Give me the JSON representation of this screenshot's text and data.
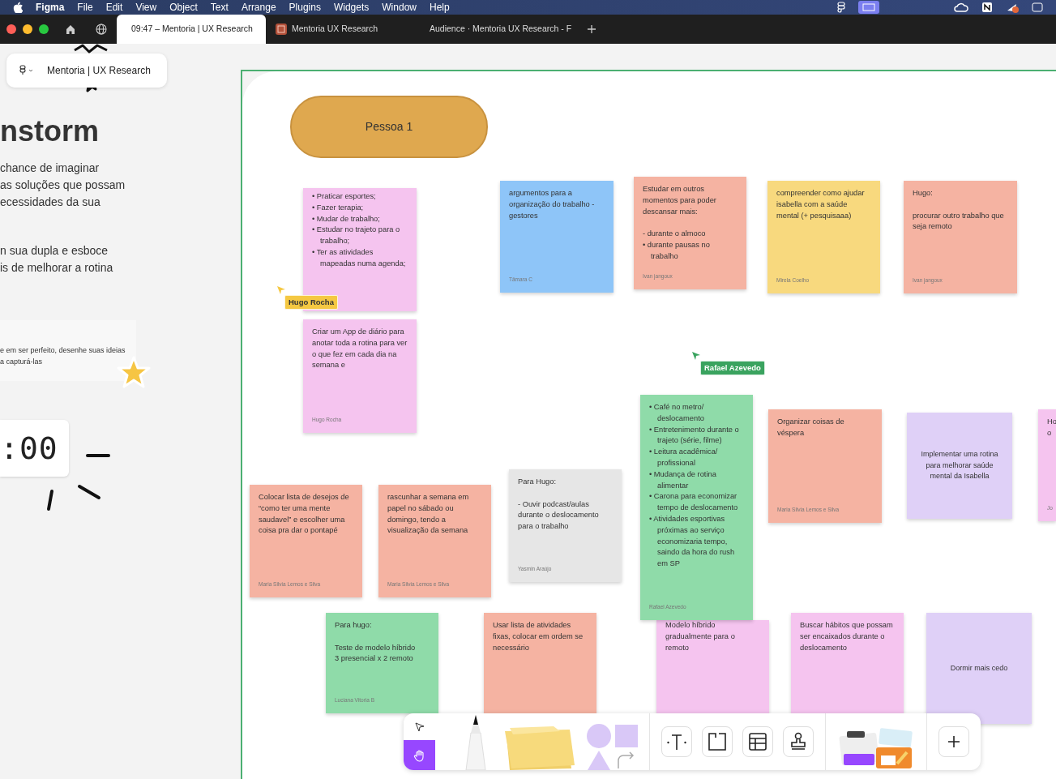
{
  "menu_bar": {
    "app": "Figma",
    "items": [
      "File",
      "Edit",
      "View",
      "Object",
      "Text",
      "Arrange",
      "Plugins",
      "Widgets",
      "Window",
      "Help"
    ]
  },
  "browser_tabs": [
    {
      "label": "09:47 – Mentoria | UX Research",
      "selected": true
    },
    {
      "label": "Mentoria UX Research",
      "selected": false
    },
    {
      "label": "Audience · Mentoria UX Research - F",
      "selected": false
    }
  ],
  "file_pill": {
    "name": "Mentoria | UX Research"
  },
  "instructions": {
    "heading": "nstorm",
    "paragraphs": [
      "chance de imaginar\nas soluções que possam\necessidades da sua",
      "n sua dupla e esboce\nis de melhorar a rotina"
    ],
    "tip": "e em ser perfeito, desenhe suas ideias\na capturá-las",
    "timer": ":00"
  },
  "section": {
    "label": "Pessoa 1"
  },
  "notes": [
    {
      "kind": "plain",
      "color": "#f5c4ef",
      "items": [
        "• Praticar esportes;",
        "• Fazer terapia;",
        "• Mudar de trabalho;",
        "• Estudar no trajeto para o trabalho;",
        "• Ter as atividades mapeadas numa agenda;"
      ]
    },
    {
      "kind": "plain",
      "color": "#8ec5f8",
      "text": "argumentos para a organização do trabalho - gestores",
      "author": "Tâmara C"
    },
    {
      "kind": "plain",
      "color": "#f5b3a2",
      "text": "Estudar em outros momentos para poder descansar mais:\n\n- durante o almoco",
      "items": [
        "• durante pausas no trabalho"
      ],
      "author": "Ivan jangoux"
    },
    {
      "kind": "plain",
      "color": "#f8d97e",
      "text": "compreender como ajudar isabella com a saúde mental (+ pesquisaaa)",
      "author": "Mirela Coelho"
    },
    {
      "kind": "plain",
      "color": "#f5b3a2",
      "text": "Hugo:\n\nprocurar outro trabalho que seja remoto",
      "author": "Ivan jangoux"
    },
    {
      "kind": "plain",
      "color": "#f5c4ef",
      "text": "Criar um App de diário para anotar toda a rotina para ver o que fez em cada dia na semana e",
      "author": "Hugo Rocha"
    },
    {
      "kind": "plain",
      "color": "#8fdba9",
      "items": [
        "• Café no metro/ deslocamento",
        "• Entretenimento durante o trajeto (série, filme)",
        "• Leitura acadêmica/ profissional",
        "• Mudança de rotina alimentar",
        "• Carona para economizar tempo de deslocamento",
        "• Atividades esportivas próximas ao serviço economizaria tempo, saindo da hora do rush em SP"
      ],
      "author": "Rafael Azevedo"
    },
    {
      "kind": "plain",
      "color": "#f5b3a2",
      "text": "Organizar coisas de véspera",
      "author": "Maria Silvia Lemos e Silva"
    },
    {
      "kind": "centered",
      "color": "#dfd0f7",
      "text": "Implementar uma rotina para melhorar saúde mental da Isabella"
    },
    {
      "kind": "plain",
      "color": "#f5c4ef",
      "text": "Ho\no",
      "author": "Jo"
    },
    {
      "kind": "plain",
      "color": "#f5b3a2",
      "text": "Colocar lista de desejos de “como ter uma mente saudavel” e escolher uma coisa pra dar o pontapé",
      "author": "Maria Silvia Lemos e Silva"
    },
    {
      "kind": "plain",
      "color": "#f5b3a2",
      "text": "rascunhar a semana em papel no sábado ou domingo, tendo a visualização da semana",
      "author": "Maria Silvia Lemos e Silva"
    },
    {
      "kind": "plain",
      "color": "#e6e6e6",
      "text": "Para Hugo:\n\n- Ouvir podcast/aulas durante o deslocamento para o trabalho",
      "author": "Yasmin Araújo"
    },
    {
      "kind": "plain",
      "color": "#8fdba9",
      "text": "Para hugo:\n\nTeste de modelo híbrido\n3 presencial x 2 remoto",
      "author": "Luciana Vitoria B"
    },
    {
      "kind": "plain",
      "color": "#f5b3a2",
      "text": "Usar lista de atividades fixas, colocar em ordem se necessário"
    },
    {
      "kind": "plain",
      "color": "#f5c4ef",
      "text": "Modelo híbrido gradualmente para o remoto"
    },
    {
      "kind": "plain",
      "color": "#f5c4ef",
      "text": "Buscar hábitos que possam ser encaixados durante o deslocamento"
    },
    {
      "kind": "centered",
      "color": "#dfd0f7",
      "text": "Dormir mais cedo"
    }
  ],
  "cursors": [
    {
      "name": "Hugo Rocha",
      "color": "#f5c842"
    },
    {
      "name": "Rafael Azevedo",
      "color": "#3aa35f"
    }
  ],
  "toolbar": {
    "tools": [
      {
        "kind": "select",
        "selected": false
      },
      {
        "kind": "hand",
        "selected": true
      },
      {
        "kind": "pen",
        "selected": false
      },
      {
        "kind": "sticky",
        "selected": false
      },
      {
        "kind": "shapes",
        "selected": false
      },
      {
        "kind": "text",
        "selected": false
      },
      {
        "kind": "section",
        "selected": false
      },
      {
        "kind": "table",
        "selected": false
      },
      {
        "kind": "stamp",
        "selected": false
      },
      {
        "kind": "widgets",
        "selected": false
      },
      {
        "kind": "add",
        "selected": false
      }
    ]
  }
}
